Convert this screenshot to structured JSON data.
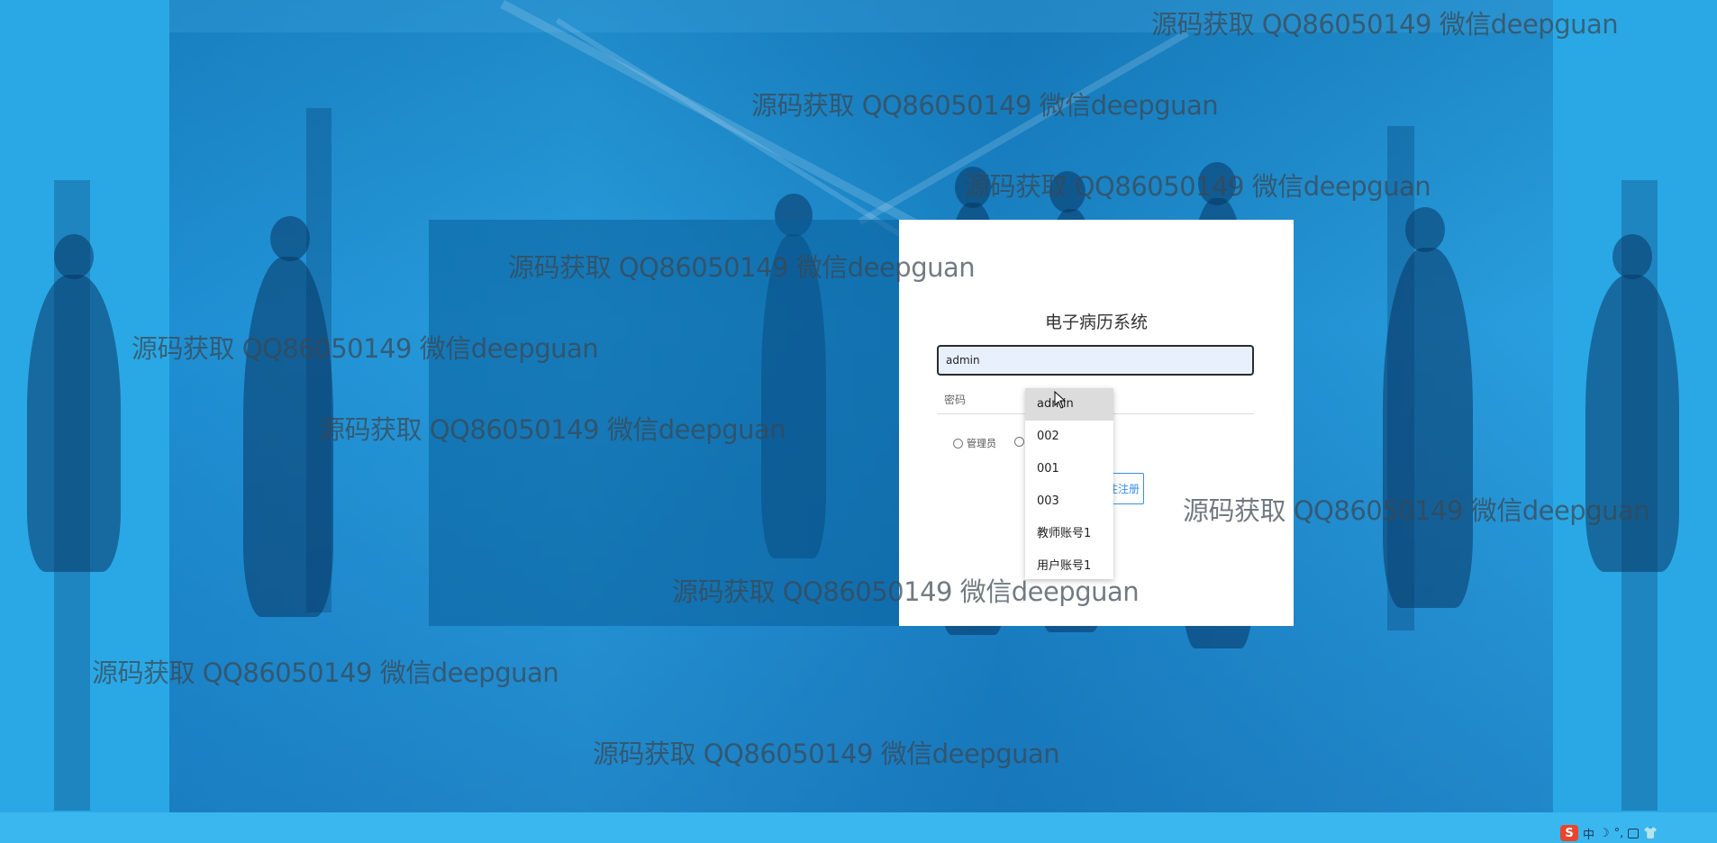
{
  "login": {
    "system_title": "电子病历系统",
    "username_value": "admin",
    "password_label": "密码",
    "role_admin_label": "管理员",
    "register_label": "注注册"
  },
  "autocomplete": {
    "items": [
      "admin",
      "002",
      "001",
      "003",
      "教师账号1",
      "用户账号1"
    ],
    "highlighted": "admin"
  },
  "watermark": {
    "text": "源码获取 QQ86050149 微信deepguan"
  },
  "tray": {
    "ime_logo": "S",
    "items": [
      "中",
      "☽",
      "°,",
      "⌨",
      "👕"
    ]
  },
  "icons": {
    "cursor": "mouse-pointer-icon",
    "ime": "sogou-ime-icon"
  }
}
